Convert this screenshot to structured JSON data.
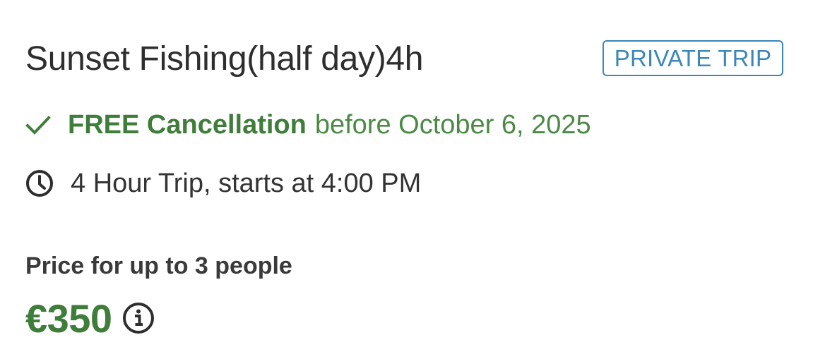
{
  "trip": {
    "title": "Sunset Fishing(half day)4h",
    "badge": "PRIVATE TRIP"
  },
  "cancellation": {
    "icon": "check-icon",
    "strong": "FREE Cancellation",
    "rest": "before October 6, 2025"
  },
  "duration": {
    "icon": "clock-icon",
    "text": "4 Hour Trip, starts at 4:00 PM"
  },
  "price": {
    "label": "Price for up to 3 people",
    "value": "€350",
    "info_icon": "info-icon"
  },
  "colors": {
    "accent_green": "#3f7d3a",
    "badge_blue": "#3a87b8",
    "text_dark": "#2e2e2e"
  }
}
